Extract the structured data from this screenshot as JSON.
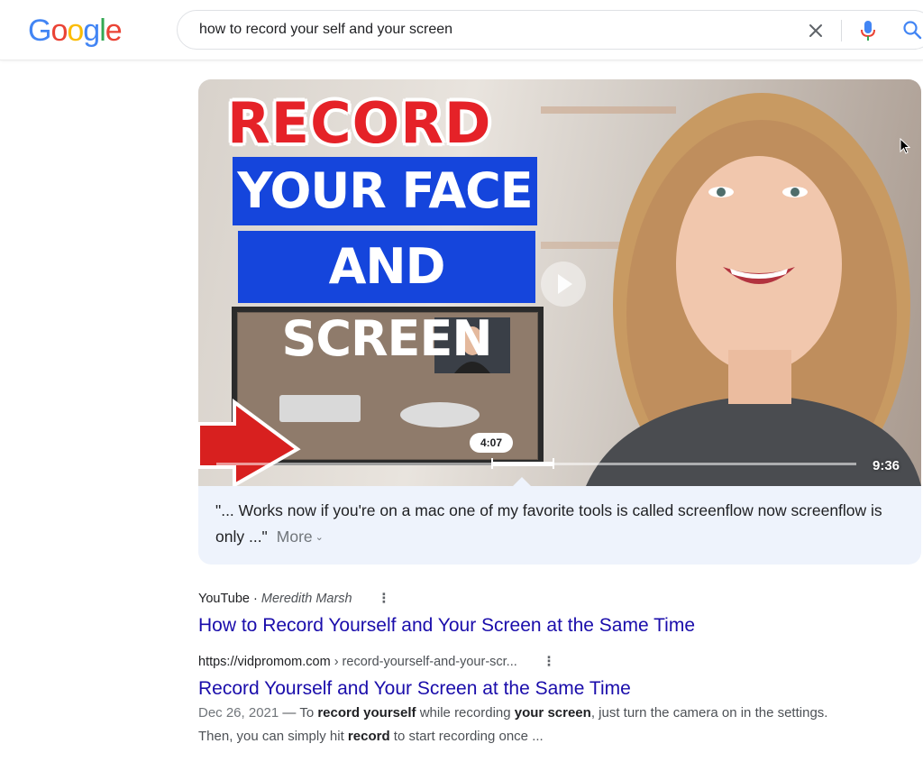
{
  "search": {
    "query": "how to record your self and your screen"
  },
  "logo": {
    "letters": [
      "G",
      "o",
      "o",
      "g",
      "l",
      "e"
    ],
    "colors": [
      "#4285F4",
      "#EA4335",
      "#FBBC05",
      "#4285F4",
      "#34A853",
      "#EA4335"
    ]
  },
  "video": {
    "thumbnail_text": {
      "line1": "RECORD",
      "line2": "YOUR FACE",
      "line3": "AND SCREEN"
    },
    "timestamp": "4:07",
    "duration": "9:36",
    "snippet": "\"... Works now if you're on a mac one of my favorite tools is called screenflow now screenflow is only ...\"",
    "more_label": "More",
    "progress_fraction": 0.43
  },
  "results": [
    {
      "source": "YouTube",
      "separator": " · ",
      "author": "Meredith Marsh",
      "title": "How to Record Yourself and Your Screen at the Same Time"
    },
    {
      "url_base": "https://vidpromom.com",
      "url_path": " › record-yourself-and-your-scr...",
      "title": "Record Yourself and Your Screen at the Same Time",
      "date": "Dec 26, 2021",
      "desc_parts": [
        "To ",
        "record yourself",
        " while recording ",
        "your screen",
        ", just turn the camera on in the settings. Then, you can simply hit ",
        "record",
        " to start recording once ..."
      ]
    }
  ],
  "colors": {
    "link": "#1a0dab",
    "banner_blue": "#1545dc",
    "record_red": "#e52228"
  }
}
